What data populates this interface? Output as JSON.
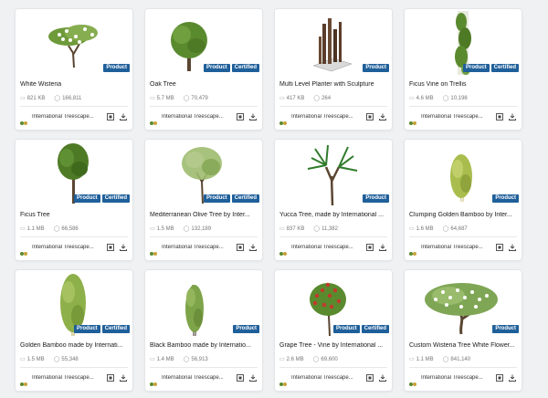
{
  "badges": {
    "product": "Product",
    "certified": "Certified"
  },
  "items": [
    {
      "title": "White Wisteria",
      "size": "821 KB",
      "downloads": "166,811",
      "author": "International Treescape...",
      "badges": [
        "Product"
      ]
    },
    {
      "title": "Oak Tree",
      "size": "5.7 MB",
      "downloads": "70,479",
      "author": "International Treescape...",
      "badges": [
        "Product",
        "Certified"
      ]
    },
    {
      "title": "Multi Level Planter with Sculpture",
      "size": "417 KB",
      "downloads": "264",
      "author": "International Treescape...",
      "badges": [
        "Product"
      ]
    },
    {
      "title": "Ficus Vine on Trellis",
      "size": "4.6 MB",
      "downloads": "10,198",
      "author": "International Treescape...",
      "badges": [
        "Product",
        "Certified"
      ]
    },
    {
      "title": "Ficus Tree",
      "size": "1.1 MB",
      "downloads": "66,586",
      "author": "International Treescape...",
      "badges": [
        "Product",
        "Certified"
      ]
    },
    {
      "title": "Mediterranean Olive Tree by Inter...",
      "size": "1.5 MB",
      "downloads": "132,189",
      "author": "International Treescape...",
      "badges": [
        "Product",
        "Certified"
      ]
    },
    {
      "title": "Yucca Tree, made by International ...",
      "size": "837 KB",
      "downloads": "11,382",
      "author": "International Treescape...",
      "badges": [
        "Product"
      ]
    },
    {
      "title": "Clumping Golden Bamboo by Inter...",
      "size": "1.6 MB",
      "downloads": "64,687",
      "author": "International Treescape...",
      "badges": [
        "Product"
      ]
    },
    {
      "title": "Golden Bamboo made by Internati...",
      "size": "1.5 MB",
      "downloads": "55,348",
      "author": "International Treescape...",
      "badges": [
        "Product",
        "Certified"
      ]
    },
    {
      "title": "Black Bamboo made by Internatio...",
      "size": "1.4 MB",
      "downloads": "56,913",
      "author": "International Treescape...",
      "badges": [
        "Product"
      ]
    },
    {
      "title": "Grape Tree - Vine by International ...",
      "size": "2.6 MB",
      "downloads": "69,600",
      "author": "International Treescape...",
      "badges": [
        "Product",
        "Certified"
      ]
    },
    {
      "title": "Custom Wisteria Tree White Flower...",
      "size": "1.1 MB",
      "downloads": "841,140",
      "author": "International Treescape...",
      "badges": [
        "Product"
      ]
    }
  ],
  "icons": {
    "size": "file-icon",
    "downloads": "comment-icon",
    "logo": "treescape-logo-icon",
    "view3d": "ar-view-icon",
    "download": "download-icon"
  },
  "colors": {
    "badge": "#1f5f9a",
    "foliage": "#5a8a2e",
    "trunk": "#5b4632",
    "blossom": "#ffffff",
    "grape": "#c23a2d"
  }
}
